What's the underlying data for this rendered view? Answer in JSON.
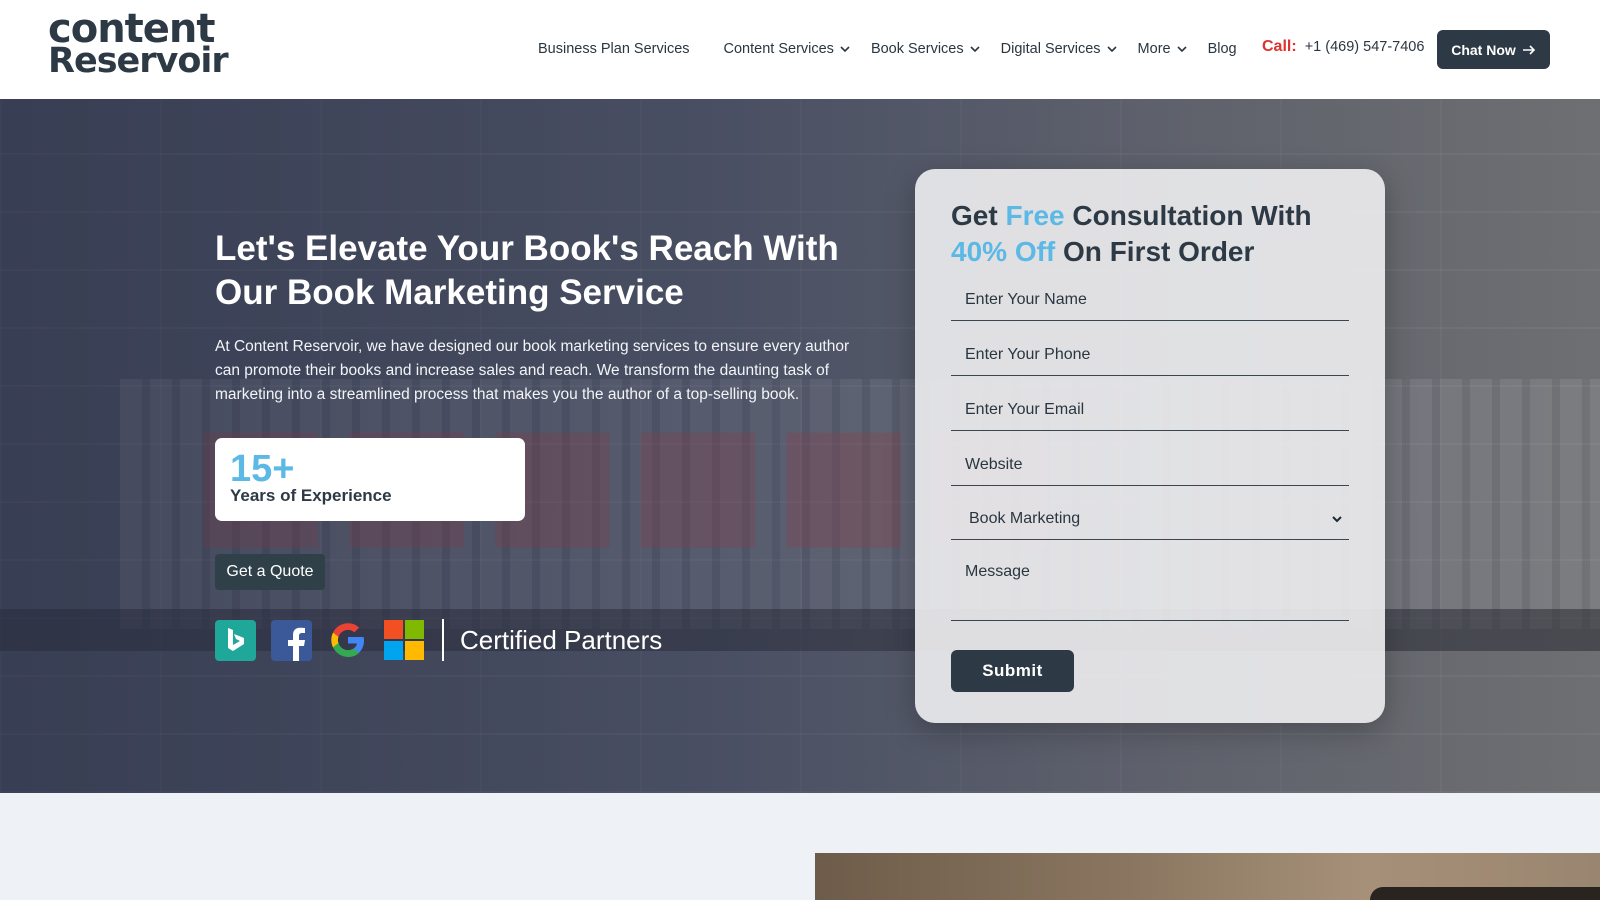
{
  "brand": {
    "line1": "content",
    "line2": "Reservoir"
  },
  "nav": {
    "items": [
      {
        "label": "Business Plan Services",
        "dropdown": false
      },
      {
        "label": "Content Services",
        "dropdown": true
      },
      {
        "label": "Book Services",
        "dropdown": true
      },
      {
        "label": "Digital Services",
        "dropdown": true
      },
      {
        "label": "More",
        "dropdown": true
      },
      {
        "label": "Blog",
        "dropdown": false
      }
    ]
  },
  "header": {
    "call_label": "Call:",
    "phone": "+1 (469) 547-7406",
    "chat_label": "Chat Now"
  },
  "hero": {
    "title": "Let's Elevate Your Book's Reach With Our Book Marketing Service",
    "description": "At Content Reservoir, we have designed our book marketing services to ensure every author can promote their books and increase sales and reach. We transform the daunting task of marketing into a streamlined process that makes you the author of a top-selling book.",
    "experience_number": "15+",
    "experience_label": "Years of Experience",
    "quote_button": "Get a Quote",
    "partners_label": "Certified Partners",
    "partner_icons": [
      "bing-icon",
      "facebook-icon",
      "google-icon",
      "microsoft-icon"
    ]
  },
  "form": {
    "title_part1": "Get ",
    "title_accent1": "Free",
    "title_part2": " Consultation With ",
    "title_accent2": "40% Off",
    "title_part3": " On First Order",
    "name_placeholder": "Enter Your Name",
    "phone_placeholder": "Enter Your Phone",
    "email_placeholder": "Enter Your Email",
    "website_placeholder": "Website",
    "service_selected": "Book Marketing",
    "message_placeholder": "Message",
    "submit_label": "Submit"
  },
  "colors": {
    "accent": "#5cb8e4",
    "dark": "#2d3a45",
    "call_red": "#e03131"
  }
}
